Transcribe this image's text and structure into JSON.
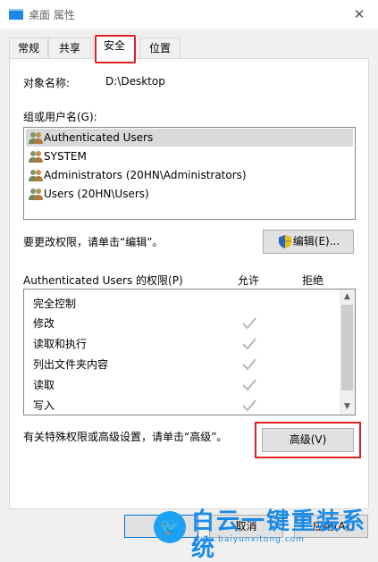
{
  "window": {
    "title": "桌面 属性",
    "close_glyph": "✕"
  },
  "tabs": [
    {
      "label": "常规",
      "active": false
    },
    {
      "label": "共享",
      "active": false
    },
    {
      "label": "安全",
      "active": true
    },
    {
      "label": "位置",
      "active": false
    }
  ],
  "object": {
    "label": "对象名称:",
    "value": "D:\\Desktop"
  },
  "groups": {
    "label": "组或用户名(G):",
    "items": [
      {
        "name": "Authenticated Users",
        "selected": true
      },
      {
        "name": "SYSTEM",
        "selected": false
      },
      {
        "name": "Administrators (20HN\\Administrators)",
        "selected": false
      },
      {
        "name": "Users (20HN\\Users)",
        "selected": false
      }
    ]
  },
  "edit": {
    "hint": "要更改权限，请单击“编辑”。",
    "button_label": "编辑(E)...",
    "icon": "uac-shield-icon"
  },
  "permissions": {
    "title": "Authenticated Users 的权限(P)",
    "allow_header": "允许",
    "deny_header": "拒绝",
    "rows": [
      {
        "label": "完全控制",
        "allow": false
      },
      {
        "label": "修改",
        "allow": true
      },
      {
        "label": "读取和执行",
        "allow": true
      },
      {
        "label": "列出文件夹内容",
        "allow": true
      },
      {
        "label": "读取",
        "allow": true
      },
      {
        "label": "写入",
        "allow": true
      }
    ]
  },
  "advanced": {
    "hint": "有关特殊权限或高级设置，请单击“高级”。",
    "button_label": "高级(V)"
  },
  "footer": {
    "ok_label": "",
    "cancel_label": "取消",
    "apply_label": "应用(A)"
  },
  "watermark": {
    "brand": "白云一键重装系统",
    "url": "www.baiyunxitong.com"
  },
  "colors": {
    "highlight_red": "#e02020",
    "check_gray": "#b8b8b8",
    "accent_blue": "#0078d7"
  }
}
